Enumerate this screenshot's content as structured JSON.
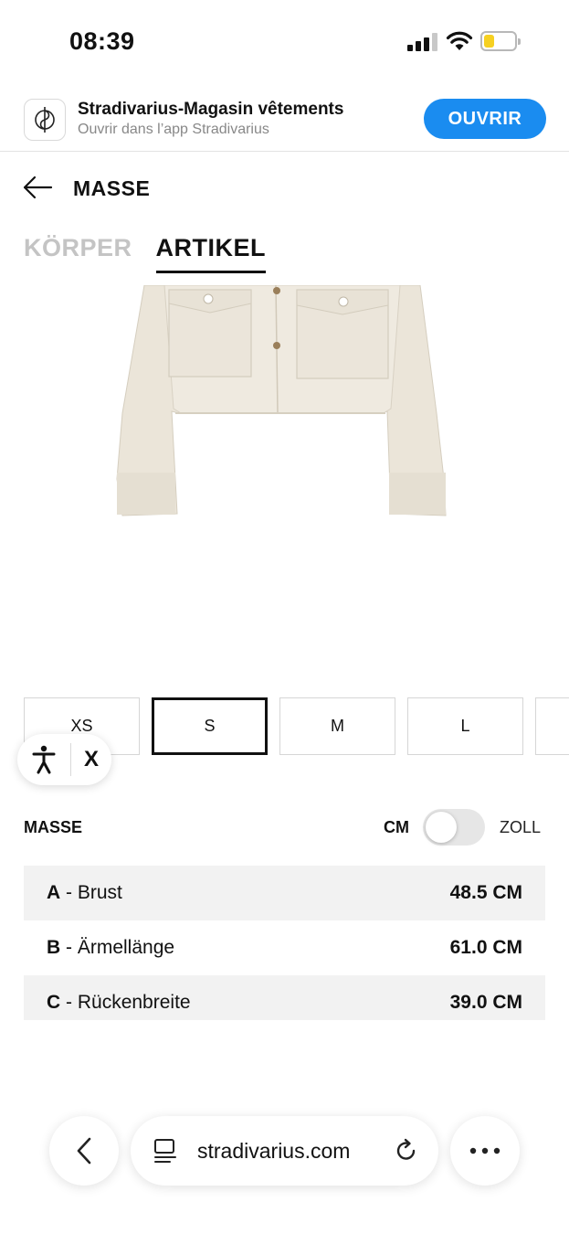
{
  "status_bar": {
    "time": "08:39",
    "signal_bars_active": 3,
    "signal_bars_total": 4,
    "battery_level": 0.25,
    "battery_color": "#f6d021"
  },
  "app_banner": {
    "app_name": "Stradivarius-Magasin vêtements",
    "subtitle": "Ouvrir dans l’app Stradivarius",
    "open_button": "OUVRIR",
    "button_color": "#1a8cf0"
  },
  "header": {
    "title": "MASSE"
  },
  "tabs": [
    {
      "label": "KÖRPER",
      "active": false
    },
    {
      "label": "ARTIKEL",
      "active": true
    }
  ],
  "sizes": [
    {
      "label": "XS",
      "selected": false
    },
    {
      "label": "S",
      "selected": true
    },
    {
      "label": "M",
      "selected": false
    },
    {
      "label": "L",
      "selected": false
    }
  ],
  "accessibility": {
    "close_label": "X"
  },
  "measurements": {
    "label": "MASSE",
    "unit_cm": "CM",
    "unit_inch": "ZOLL",
    "toggle_on": false,
    "rows": [
      {
        "key": "A",
        "name": "Brust",
        "value": "48.5 CM"
      },
      {
        "key": "B",
        "name": "Ärmellänge",
        "value": "61.0 CM"
      },
      {
        "key": "C",
        "name": "Rückenbreite",
        "value": "39.0 CM"
      }
    ]
  },
  "browser": {
    "url": "stradivarius.com"
  }
}
